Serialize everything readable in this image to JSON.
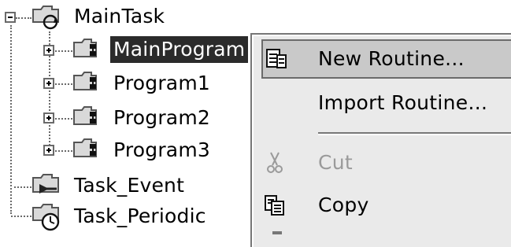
{
  "tree": {
    "task": {
      "label": "MainTask",
      "icon": "task-folder-icon",
      "expanded": true
    },
    "programs": [
      {
        "label": "MainProgram",
        "icon": "program-folder-icon",
        "selected": true
      },
      {
        "label": "Program1",
        "icon": "program-folder-icon",
        "selected": false
      },
      {
        "label": "Program2",
        "icon": "program-folder-icon",
        "selected": false
      },
      {
        "label": "Program3",
        "icon": "program-folder-icon",
        "selected": false
      }
    ],
    "other_tasks": [
      {
        "label": "Task_Event",
        "icon": "event-task-icon"
      },
      {
        "label": "Task_Periodic",
        "icon": "periodic-task-icon"
      }
    ]
  },
  "context_menu": {
    "items": [
      {
        "label": "New Routine...",
        "icon": "new-routine-icon",
        "highlighted": true,
        "enabled": true
      },
      {
        "label": "Import Routine...",
        "icon": "",
        "highlighted": false,
        "enabled": true
      },
      {
        "label": "Cut",
        "icon": "scissors-icon",
        "highlighted": false,
        "enabled": false
      },
      {
        "label": "Copy",
        "icon": "copy-icon",
        "highlighted": false,
        "enabled": true
      }
    ]
  },
  "colors": {
    "selection": "#2b2b2b",
    "menu_bg": "#eaeaea",
    "menu_highlight": "#c9c9c9",
    "disabled_text": "#9a9a9a"
  }
}
